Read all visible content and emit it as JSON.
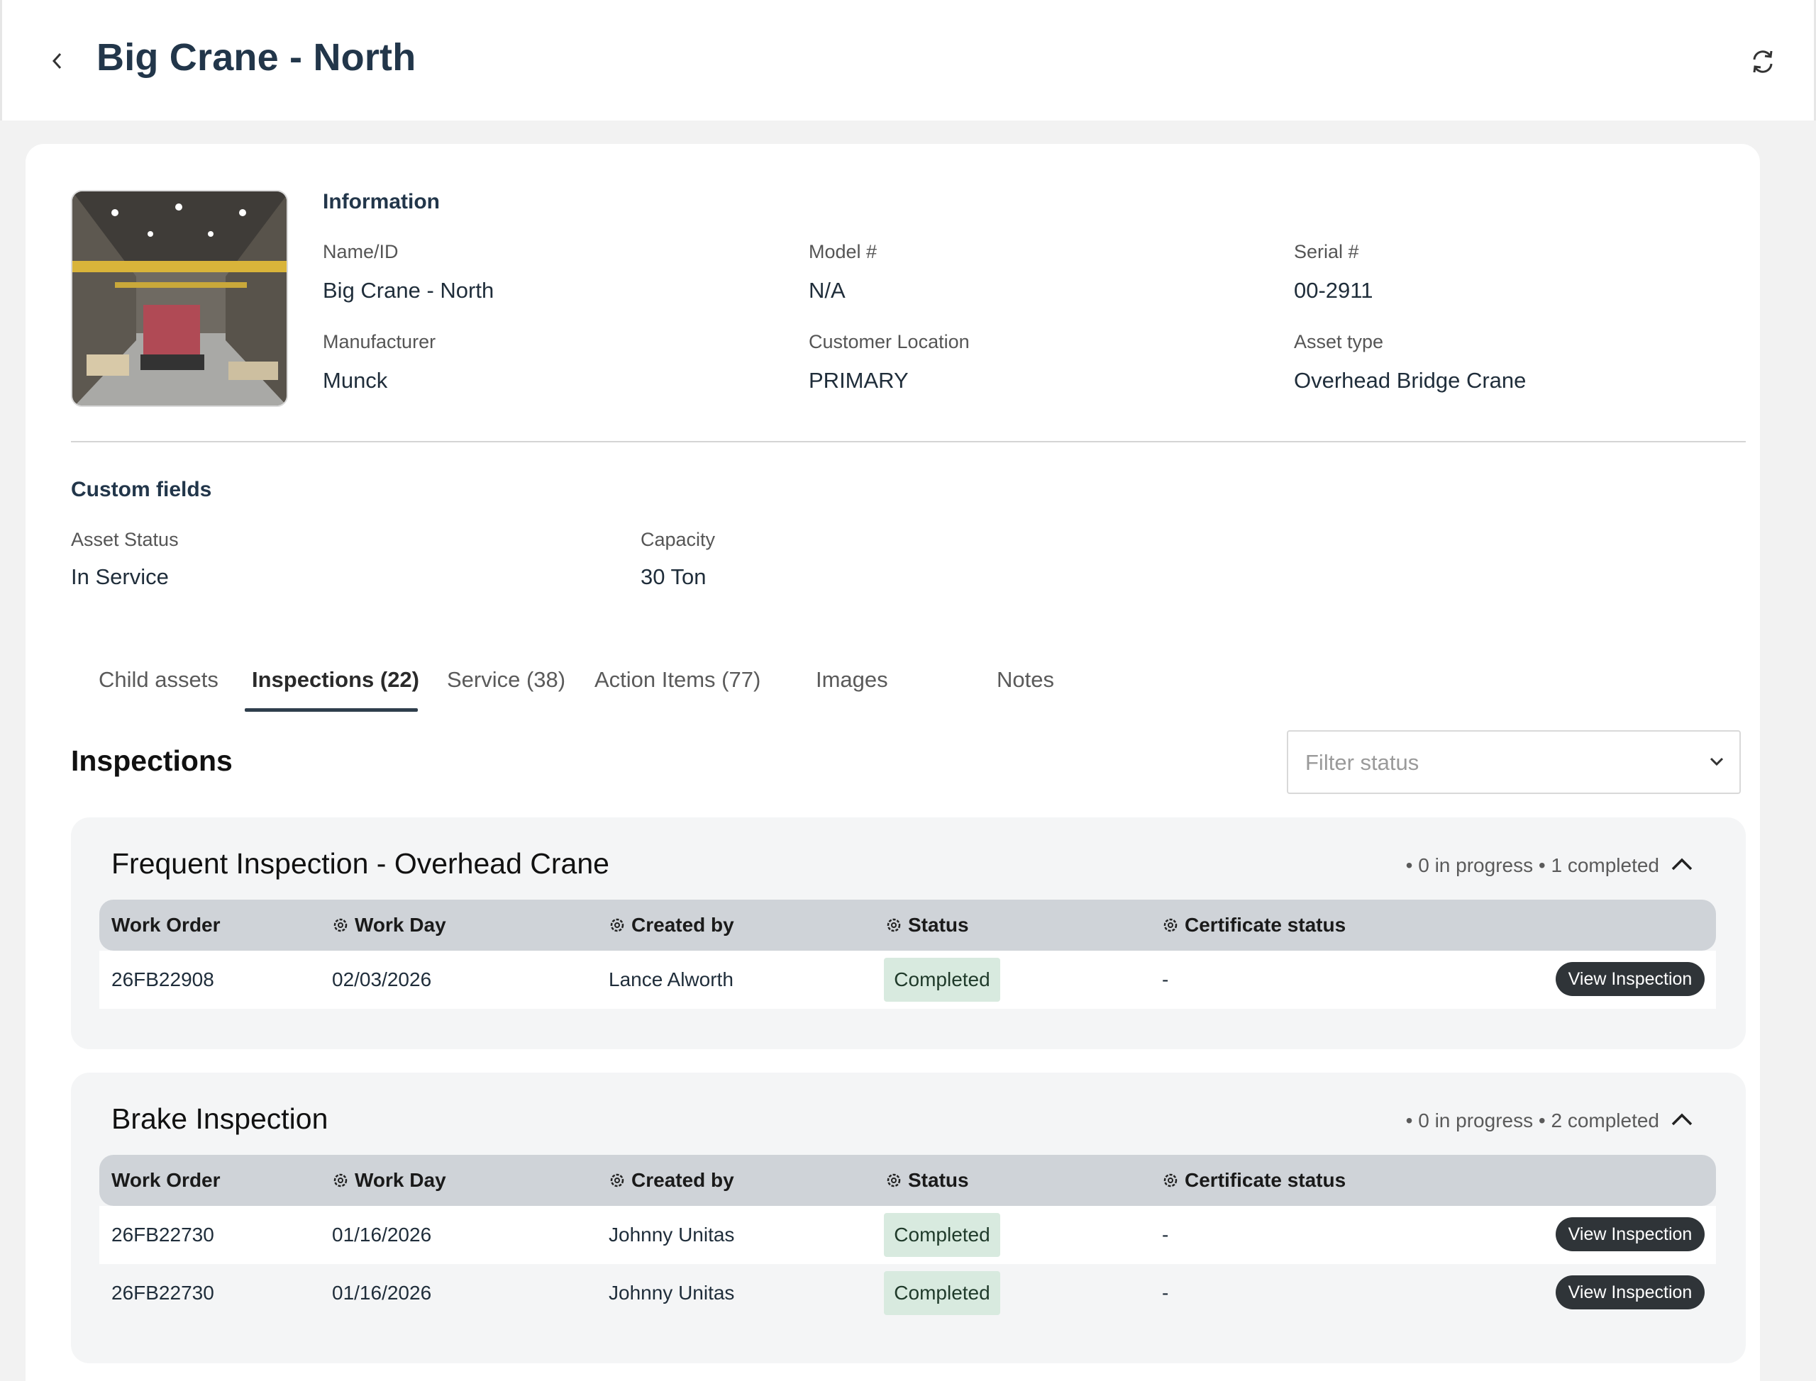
{
  "header": {
    "title": "Big Crane - North",
    "back_icon": "chevron-left-icon",
    "refresh_icon": "refresh-icon"
  },
  "information": {
    "heading": "Information",
    "fields": {
      "name_id": {
        "label": "Name/ID",
        "value": "Big Crane - North"
      },
      "model": {
        "label": "Model #",
        "value": "N/A"
      },
      "serial": {
        "label": "Serial #",
        "value": "00-2911"
      },
      "manufacturer": {
        "label": "Manufacturer",
        "value": "Munck"
      },
      "customer_location": {
        "label": "Customer Location",
        "value": "PRIMARY"
      },
      "asset_type": {
        "label": "Asset type",
        "value": "Overhead Bridge Crane"
      }
    }
  },
  "custom_fields": {
    "heading": "Custom fields",
    "asset_status": {
      "label": "Asset Status",
      "value": "In Service"
    },
    "capacity": {
      "label": "Capacity",
      "value": "30 Ton"
    }
  },
  "tabs": [
    {
      "label": "Child assets",
      "active": false
    },
    {
      "label": "Inspections (22)",
      "active": true
    },
    {
      "label": "Service (38)",
      "active": false
    },
    {
      "label": "Action Items (77)",
      "active": false
    },
    {
      "label": "Images",
      "active": false
    },
    {
      "label": "Notes",
      "active": false
    }
  ],
  "inspections": {
    "heading": "Inspections",
    "filter": {
      "placeholder": "Filter status",
      "icon": "chevron-down-icon"
    },
    "columns": [
      "Work Order",
      "Work Day",
      "Created by",
      "Status",
      "Certificate status"
    ],
    "view_button_label": "View Inspection",
    "groups": [
      {
        "title": "Frequent Inspection - Overhead Crane",
        "summary": "• 0 in progress • 1 completed",
        "rows": [
          {
            "work_order": "26FB22908",
            "work_day": "02/03/2026",
            "created_by": "Lance Alworth",
            "status": "Completed",
            "certificate_status": "-"
          }
        ]
      },
      {
        "title": "Brake Inspection",
        "summary": "• 0 in progress • 2 completed",
        "rows": [
          {
            "work_order": "26FB22730",
            "work_day": "01/16/2026",
            "created_by": "Johnny Unitas",
            "status": "Completed",
            "certificate_status": "-"
          },
          {
            "work_order": "26FB22730",
            "work_day": "01/16/2026",
            "created_by": "Johnny Unitas",
            "status": "Completed",
            "certificate_status": "-"
          }
        ]
      }
    ]
  },
  "colors": {
    "title": "#22364a",
    "status_completed_bg": "#d8eadf",
    "view_button_bg": "#2f3438",
    "table_header_bg": "#cfd3d8"
  }
}
